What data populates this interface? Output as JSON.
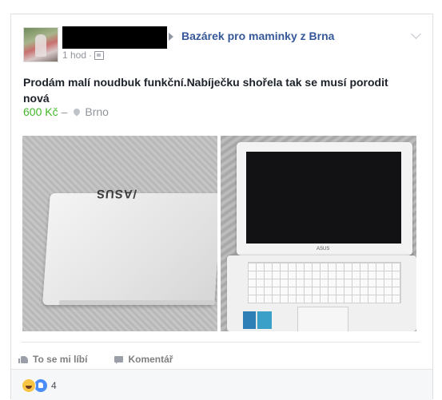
{
  "post": {
    "group_name": "Bazárek pro maminky z Brna",
    "timestamp": "1 hod",
    "separator": "·",
    "audience_icon": "group-audience-icon",
    "text": "Prodám malí noudbuk funkční.Nabíječku shořela tak se musí porodit nová",
    "price": "600 Kč",
    "dash": "–",
    "location": "Brno",
    "photos": [
      {
        "brand_logo": "/ASUS",
        "description_icon": "closed-laptop"
      },
      {
        "brand_logo": "ASUS",
        "description_icon": "open-laptop"
      }
    ]
  },
  "actions": {
    "like_label": "To se mi líbí",
    "comment_label": "Komentář"
  },
  "reactions": {
    "icons": [
      "haha-icon",
      "like-icon"
    ],
    "count": "4"
  },
  "colors": {
    "link": "#365899",
    "price": "#42b72a",
    "meta": "#90949c",
    "text": "#1d2129"
  }
}
